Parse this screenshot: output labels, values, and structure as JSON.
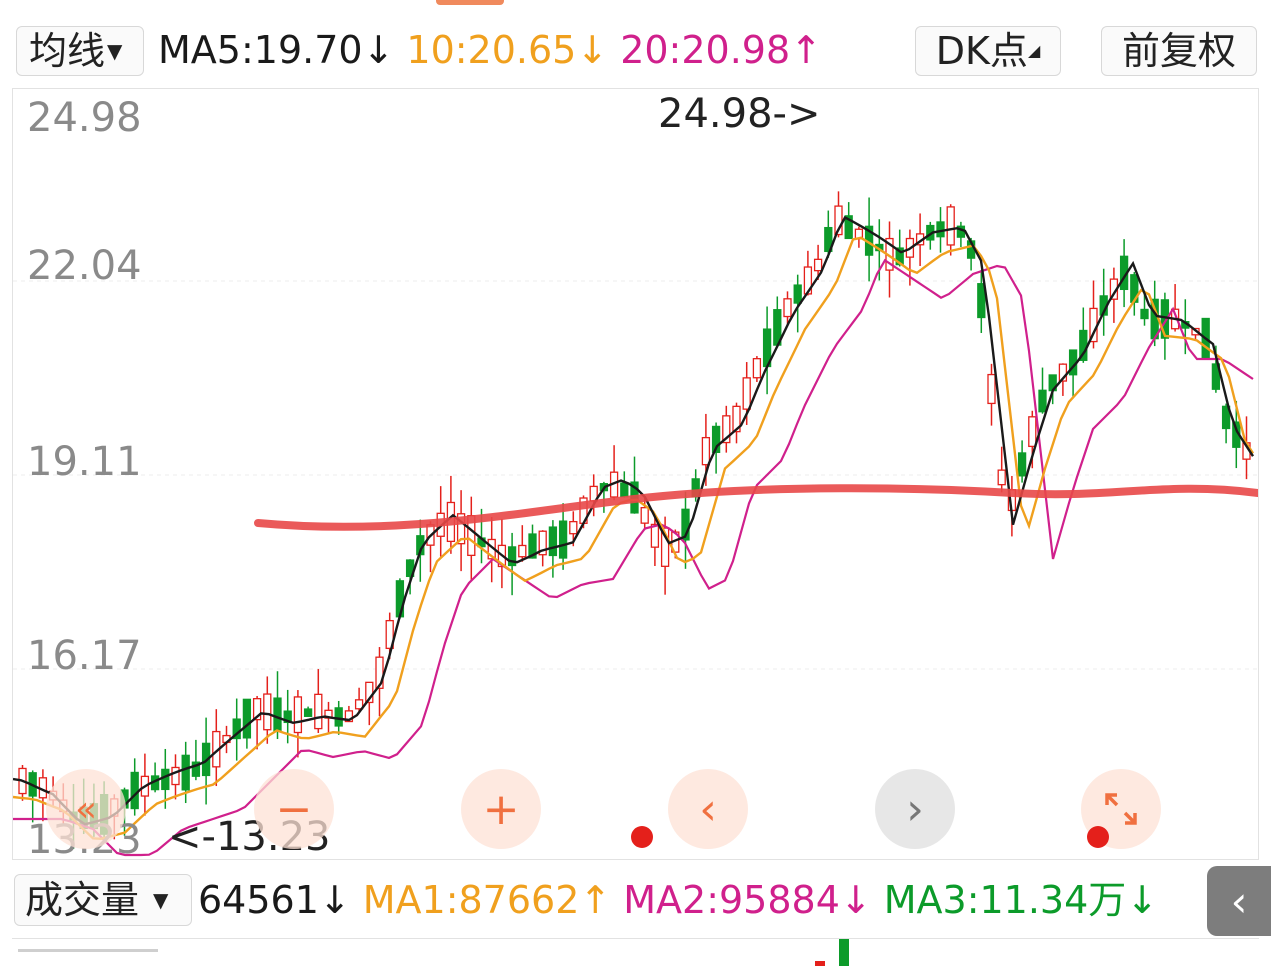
{
  "header": {
    "avg_label": "均线",
    "ma5": "MA5:19.70",
    "ma5_arrow": "↓",
    "ma10": "10:20.65",
    "ma10_arrow": "↓",
    "ma20": "20:20.98",
    "ma20_arrow": "↑",
    "dk_label": "DK点",
    "restore_label": "前复权"
  },
  "chart": {
    "price_labels": [
      "24.98",
      "22.04",
      "19.11",
      "16.17",
      "13.23"
    ],
    "high_annotation": "24.98->",
    "low_annotation": "<-13.23",
    "colors": {
      "up": "#e4201b",
      "down": "#0c9b2a",
      "ma5": "#1a1a1a",
      "ma10": "#f0a01e",
      "ma20": "#d0208c",
      "trend": "#e84848"
    }
  },
  "controls": {
    "icons": [
      "rewind-icon",
      "minus-icon",
      "plus-icon",
      "chevron-left-icon",
      "chevron-right-icon",
      "expand-icon"
    ]
  },
  "volume": {
    "label": "成交量",
    "value": "64561",
    "value_arrow": "↓",
    "ma1": "MA1:87662",
    "ma1_arrow": "↑",
    "ma2": "MA2:95884",
    "ma2_arrow": "↓",
    "ma3": "MA3:11.34万",
    "ma3_arrow": "↓"
  }
}
